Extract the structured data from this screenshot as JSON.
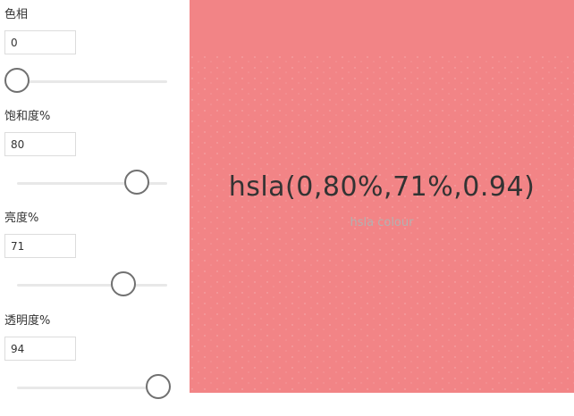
{
  "controls": [
    {
      "label": "色相",
      "value": "0",
      "fraction": 0.0
    },
    {
      "label": "饱和度%",
      "value": "80",
      "fraction": 0.8
    },
    {
      "label": "亮度%",
      "value": "71",
      "fraction": 0.71
    },
    {
      "label": "透明度%",
      "value": "94",
      "fraction": 0.94
    }
  ],
  "preview": {
    "value_text": "hsla(0,80%,71%,0.94)",
    "caption": "hsla colour",
    "background": "#f28486"
  },
  "colors": {
    "text": "#333333",
    "caption": "#b2b2b2",
    "slider_thumb": "#707070"
  }
}
